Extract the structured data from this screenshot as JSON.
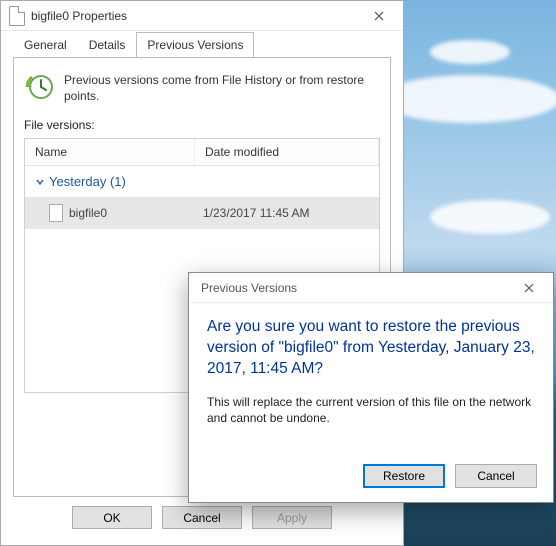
{
  "window": {
    "title": "bigfile0 Properties",
    "tabs": {
      "general": "General",
      "details": "Details",
      "previous": "Previous Versions"
    },
    "hint": "Previous versions come from File History or from restore points.",
    "section_label": "File versions:",
    "columns": {
      "name": "Name",
      "date": "Date modified"
    },
    "group": {
      "label": "Yesterday (1)"
    },
    "file": {
      "name": "bigfile0",
      "date": "1/23/2017 11:45 AM"
    },
    "buttons": {
      "ok": "OK",
      "cancel": "Cancel",
      "apply": "Apply"
    }
  },
  "dialog": {
    "title": "Previous Versions",
    "main": "Are you sure you want to restore the previous version of \"bigfile0\" from Yesterday, January 23, 2017, 11:45 AM?",
    "sub": "This will replace the current version of this file on the network and cannot be undone.",
    "buttons": {
      "restore": "Restore",
      "cancel": "Cancel"
    }
  }
}
